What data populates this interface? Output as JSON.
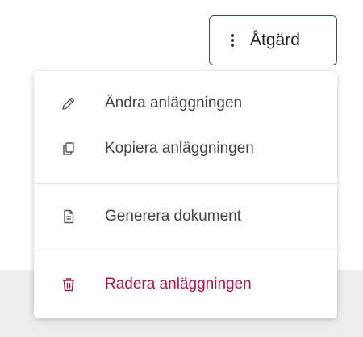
{
  "action_button": {
    "label": "Åtgärd",
    "icon": "kebab-vertical-icon"
  },
  "menu": {
    "items": [
      {
        "label": "Ändra anläggningen",
        "icon": "pencil-icon"
      },
      {
        "label": "Kopiera anläggningen",
        "icon": "copy-icon"
      },
      {
        "label": "Generera dokument",
        "icon": "document-icon"
      },
      {
        "label": "Radera anläggningen",
        "icon": "trash-icon"
      }
    ]
  },
  "colors": {
    "button_border": "#2f4f5a",
    "text": "#444444",
    "danger": "#b3134a",
    "background_strip": "#eeeeee"
  }
}
